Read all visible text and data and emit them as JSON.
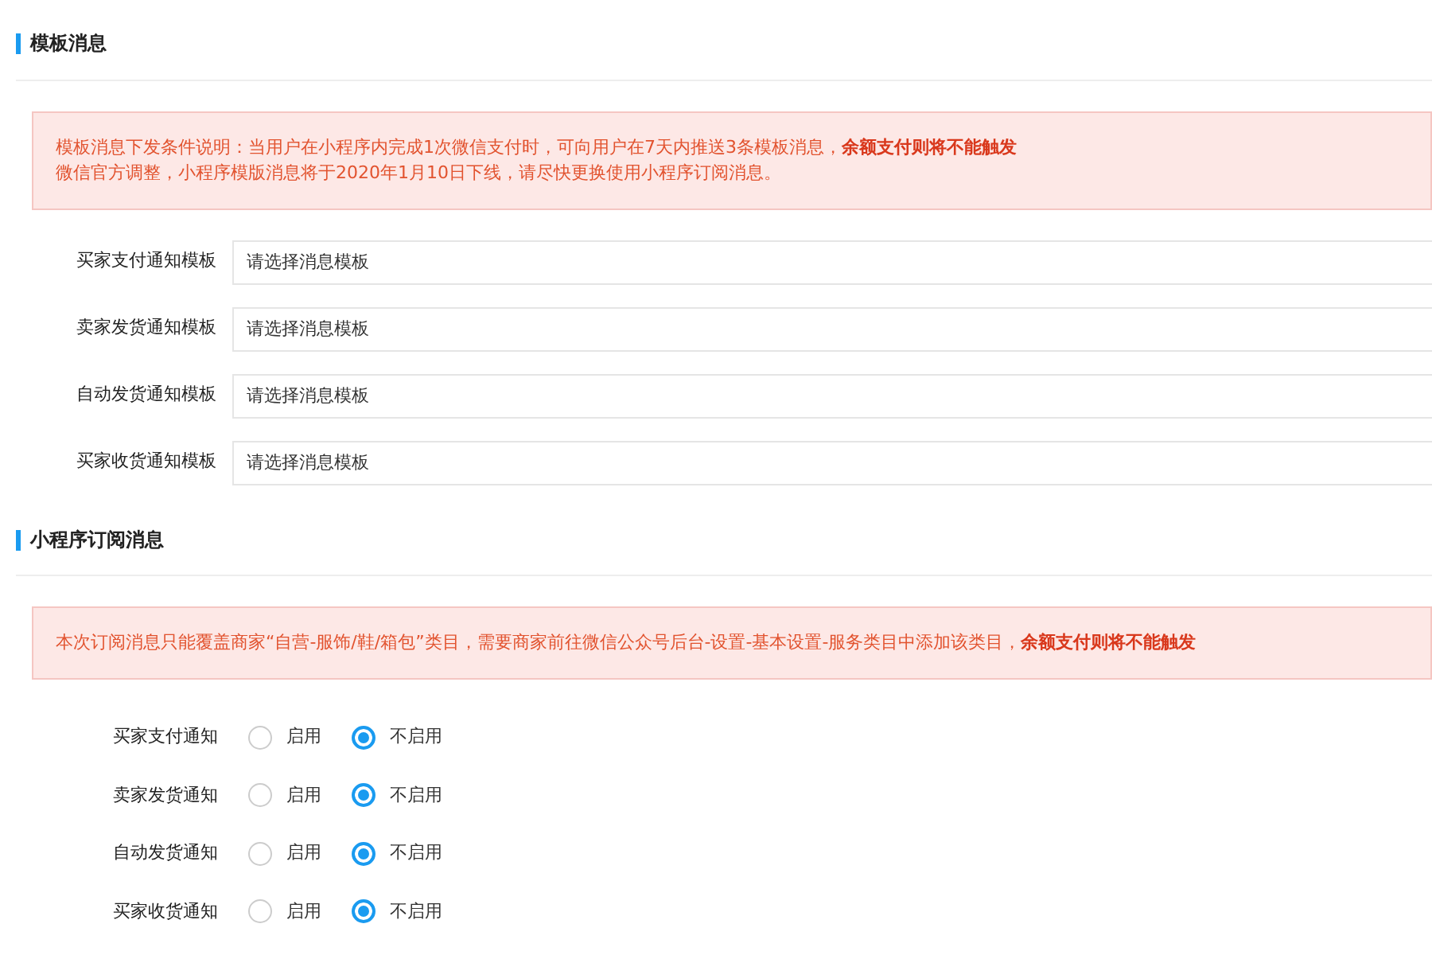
{
  "sections": [
    {
      "title": "模板消息",
      "notice": [
        "模板消息下发条件说明：当用户在小程序内完成1次微信支付时，可向用户在7天内推送3条模板消息，**余额支付则将不能触发**",
        "微信官方调整，小程序模版消息将于2020年1月10日下线，请尽快更换使用小程序订阅消息。"
      ],
      "rows": [
        {
          "kind": "select",
          "label": "买家支付通知模板",
          "placeholder": "请选择消息模板"
        },
        {
          "kind": "select",
          "label": "卖家发货通知模板",
          "placeholder": "请选择消息模板"
        },
        {
          "kind": "select",
          "label": "自动发货通知模板",
          "placeholder": "请选择消息模板"
        },
        {
          "kind": "select",
          "label": "买家收货通知模板",
          "placeholder": "请选择消息模板"
        }
      ]
    },
    {
      "title": "小程序订阅消息",
      "notice": [
        "本次订阅消息只能覆盖商家“自营-服饰/鞋/箱包”类目，需要商家前往微信公众号后台-设置-基本设置-服务类目中添加该类目，**余额支付则将不能触发**"
      ],
      "rows": [
        {
          "kind": "radio",
          "label": "买家支付通知",
          "options": [
            {
              "label": "启用",
              "selected": false
            },
            {
              "label": "不启用",
              "selected": true
            }
          ]
        },
        {
          "kind": "radio",
          "label": "卖家发货通知",
          "options": [
            {
              "label": "启用",
              "selected": false
            },
            {
              "label": "不启用",
              "selected": true
            }
          ]
        },
        {
          "kind": "radio",
          "label": "自动发货通知",
          "options": [
            {
              "label": "启用",
              "selected": false
            },
            {
              "label": "不启用",
              "selected": true
            }
          ]
        },
        {
          "kind": "radio",
          "label": "买家收货通知",
          "options": [
            {
              "label": "启用",
              "selected": false
            },
            {
              "label": "不启用",
              "selected": true
            }
          ]
        }
      ]
    }
  ]
}
